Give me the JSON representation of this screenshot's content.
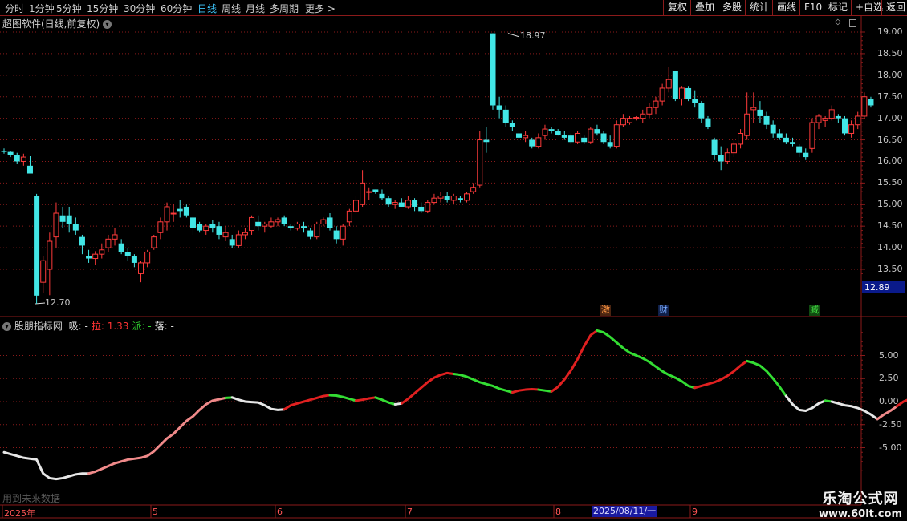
{
  "toolbar": {
    "periods": [
      "分时",
      "1分钟",
      "5分钟",
      "15分钟",
      "30分钟",
      "60分钟",
      "日线",
      "周线",
      "月线",
      "多周期",
      "更多 >"
    ],
    "active_period": "日线",
    "right_buttons": [
      "复权",
      "叠加",
      "多股",
      "统计",
      "画线",
      "F10",
      "标记",
      "+自选",
      "返回"
    ]
  },
  "main_chart": {
    "title": "超图软件(日线,前复权)",
    "y_ticks": [
      "19.00",
      "18.50",
      "18.00",
      "17.50",
      "17.00",
      "16.50",
      "16.00",
      "15.50",
      "15.00",
      "14.50",
      "14.00",
      "13.50"
    ],
    "high_label": "18.97",
    "low_label": "12.70",
    "current_price": "12.89",
    "events": [
      {
        "label": "激",
        "color": "#ff9944"
      },
      {
        "label": "财",
        "color": "#77aaff"
      },
      {
        "label": "减",
        "color": "#44dd44"
      }
    ]
  },
  "indicator": {
    "name": "股朋指标网",
    "fields": [
      {
        "label": "吸:",
        "value": "-",
        "color": "#e0e0e0"
      },
      {
        "label": "拉:",
        "value": "1.33",
        "color": "#ff3333"
      },
      {
        "label": "派:",
        "value": "-",
        "color": "#33dd33"
      },
      {
        "label": "落:",
        "value": "-",
        "color": "#e0e0e0"
      }
    ],
    "y_ticks": [
      "5.00",
      "2.50",
      "0.00",
      "-2.50",
      "-5.00"
    ],
    "note": "用到未来数据"
  },
  "time_axis": {
    "labels": [
      "2025年",
      "5",
      "6",
      "7",
      "8",
      "9"
    ],
    "cursor_date": "2025/08/11/一"
  },
  "watermark": {
    "line1": "乐淘公式网",
    "line2": "www.60lt.com"
  },
  "colors": {
    "up": "#ff3b3b",
    "down": "#42e6e6",
    "grid": "#8b1a1a",
    "bg": "#000000"
  },
  "chart_data": {
    "type": "candlestick",
    "ylim": [
      12.5,
      19.1
    ],
    "candles": [
      [
        16.25,
        16.3,
        16.18,
        16.22
      ],
      [
        16.22,
        16.25,
        16.1,
        16.15
      ],
      [
        16.15,
        16.2,
        15.95,
        16.0
      ],
      [
        16.0,
        16.18,
        15.9,
        16.1
      ],
      [
        15.9,
        16.12,
        15.8,
        15.72
      ],
      [
        15.2,
        15.25,
        12.7,
        12.89
      ],
      [
        13.2,
        13.8,
        12.95,
        13.7
      ],
      [
        13.5,
        14.35,
        12.9,
        14.15
      ],
      [
        14.25,
        15.05,
        14.0,
        14.8
      ],
      [
        14.75,
        14.95,
        14.45,
        14.6
      ],
      [
        14.75,
        14.95,
        14.35,
        14.55
      ],
      [
        14.55,
        14.7,
        14.3,
        14.4
      ],
      [
        14.25,
        14.3,
        13.85,
        14.05
      ],
      [
        13.8,
        13.95,
        13.65,
        13.75
      ],
      [
        13.75,
        13.92,
        13.6,
        13.85
      ],
      [
        13.85,
        14.1,
        13.75,
        13.95
      ],
      [
        14.0,
        14.3,
        13.9,
        14.2
      ],
      [
        14.2,
        14.45,
        14.05,
        14.3
      ],
      [
        14.1,
        14.2,
        13.85,
        13.9
      ],
      [
        13.9,
        14.0,
        13.7,
        13.8
      ],
      [
        13.8,
        13.85,
        13.55,
        13.65
      ],
      [
        13.4,
        13.7,
        13.2,
        13.65
      ],
      [
        13.65,
        13.95,
        13.55,
        13.9
      ],
      [
        14.0,
        14.3,
        13.95,
        14.25
      ],
      [
        14.35,
        14.7,
        14.2,
        14.6
      ],
      [
        14.6,
        15.05,
        14.4,
        14.95
      ],
      [
        14.8,
        15.0,
        14.6,
        14.8
      ],
      [
        14.9,
        15.1,
        14.7,
        14.85
      ],
      [
        14.95,
        15.0,
        14.7,
        14.75
      ],
      [
        14.7,
        14.75,
        14.3,
        14.45
      ],
      [
        14.55,
        14.6,
        14.35,
        14.4
      ],
      [
        14.4,
        14.55,
        14.3,
        14.5
      ],
      [
        14.55,
        14.65,
        14.35,
        14.45
      ],
      [
        14.5,
        14.6,
        14.2,
        14.3
      ],
      [
        14.25,
        14.5,
        14.15,
        14.35
      ],
      [
        14.2,
        14.3,
        14.0,
        14.05
      ],
      [
        14.05,
        14.4,
        14.0,
        14.3
      ],
      [
        14.3,
        14.45,
        14.2,
        14.35
      ],
      [
        14.4,
        14.75,
        14.3,
        14.7
      ],
      [
        14.6,
        14.75,
        14.4,
        14.5
      ],
      [
        14.5,
        14.6,
        14.35,
        14.55
      ],
      [
        14.5,
        14.7,
        14.45,
        14.6
      ],
      [
        14.6,
        14.7,
        14.5,
        14.65
      ],
      [
        14.7,
        14.75,
        14.5,
        14.55
      ],
      [
        14.5,
        14.55,
        14.4,
        14.45
      ],
      [
        14.45,
        14.6,
        14.4,
        14.55
      ],
      [
        14.5,
        14.6,
        14.35,
        14.45
      ],
      [
        14.4,
        14.45,
        14.2,
        14.25
      ],
      [
        14.25,
        14.6,
        14.2,
        14.55
      ],
      [
        14.55,
        14.7,
        14.5,
        14.65
      ],
      [
        14.7,
        14.8,
        14.4,
        14.45
      ],
      [
        14.4,
        14.5,
        14.1,
        14.2
      ],
      [
        14.2,
        14.55,
        14.05,
        14.5
      ],
      [
        14.6,
        14.9,
        14.5,
        14.85
      ],
      [
        14.85,
        15.2,
        14.8,
        15.1
      ],
      [
        15.0,
        15.8,
        14.95,
        15.5
      ],
      [
        15.3,
        15.4,
        15.1,
        15.3
      ],
      [
        15.35,
        15.35,
        15.25,
        15.3
      ],
      [
        15.25,
        15.35,
        15.1,
        15.15
      ],
      [
        15.15,
        15.2,
        14.95,
        15.0
      ],
      [
        15.0,
        15.1,
        14.9,
        15.05
      ],
      [
        15.05,
        15.15,
        14.95,
        14.95
      ],
      [
        14.95,
        15.2,
        14.9,
        15.1
      ],
      [
        15.1,
        15.15,
        14.85,
        14.95
      ],
      [
        14.95,
        15.05,
        14.8,
        14.85
      ],
      [
        14.85,
        15.1,
        14.8,
        15.05
      ],
      [
        15.05,
        15.25,
        15.0,
        15.15
      ],
      [
        15.15,
        15.3,
        15.05,
        15.2
      ],
      [
        15.2,
        15.3,
        15.05,
        15.1
      ],
      [
        15.1,
        15.25,
        15.0,
        15.2
      ],
      [
        15.15,
        15.2,
        15.05,
        15.1
      ],
      [
        15.1,
        15.3,
        15.05,
        15.25
      ],
      [
        15.3,
        15.5,
        15.25,
        15.4
      ],
      [
        15.45,
        16.7,
        15.4,
        16.5
      ],
      [
        16.5,
        16.8,
        16.2,
        16.45
      ],
      [
        18.97,
        18.97,
        17.2,
        17.3
      ],
      [
        17.3,
        17.5,
        17.0,
        17.2
      ],
      [
        17.2,
        17.3,
        16.8,
        16.9
      ],
      [
        16.9,
        16.95,
        16.7,
        16.8
      ],
      [
        16.65,
        16.7,
        16.45,
        16.55
      ],
      [
        16.55,
        16.7,
        16.45,
        16.6
      ],
      [
        16.5,
        16.55,
        16.3,
        16.35
      ],
      [
        16.35,
        16.65,
        16.3,
        16.55
      ],
      [
        16.6,
        16.85,
        16.5,
        16.75
      ],
      [
        16.75,
        16.8,
        16.65,
        16.7
      ],
      [
        16.7,
        16.75,
        16.6,
        16.62
      ],
      [
        16.62,
        16.7,
        16.5,
        16.55
      ],
      [
        16.6,
        16.65,
        16.4,
        16.45
      ],
      [
        16.45,
        16.7,
        16.4,
        16.65
      ],
      [
        16.55,
        16.6,
        16.4,
        16.45
      ],
      [
        16.45,
        16.8,
        16.4,
        16.75
      ],
      [
        16.75,
        16.85,
        16.6,
        16.65
      ],
      [
        16.65,
        16.7,
        16.4,
        16.45
      ],
      [
        16.45,
        16.6,
        16.3,
        16.35
      ],
      [
        16.35,
        16.95,
        16.3,
        16.85
      ],
      [
        16.85,
        17.1,
        16.8,
        17.0
      ],
      [
        16.9,
        17.05,
        16.85,
        17.0
      ],
      [
        17.0,
        17.05,
        16.95,
        17.02
      ],
      [
        17.0,
        17.2,
        16.9,
        17.1
      ],
      [
        17.1,
        17.35,
        17.0,
        17.25
      ],
      [
        17.25,
        17.5,
        17.1,
        17.4
      ],
      [
        17.4,
        17.8,
        17.3,
        17.7
      ],
      [
        17.7,
        18.2,
        17.6,
        17.9
      ],
      [
        18.1,
        18.1,
        17.4,
        17.45
      ],
      [
        17.45,
        17.75,
        17.3,
        17.7
      ],
      [
        17.7,
        17.75,
        17.4,
        17.45
      ],
      [
        17.45,
        17.65,
        17.25,
        17.35
      ],
      [
        17.35,
        17.4,
        16.9,
        17.0
      ],
      [
        17.0,
        17.05,
        16.75,
        16.8
      ],
      [
        16.5,
        16.55,
        16.05,
        16.15
      ],
      [
        16.15,
        16.35,
        15.8,
        16.0
      ],
      [
        16.0,
        16.3,
        15.95,
        16.2
      ],
      [
        16.2,
        16.5,
        16.1,
        16.4
      ],
      [
        16.4,
        16.75,
        16.3,
        16.65
      ],
      [
        16.6,
        17.6,
        16.5,
        17.1
      ],
      [
        17.2,
        17.6,
        16.9,
        17.25
      ],
      [
        17.2,
        17.4,
        16.9,
        17.05
      ],
      [
        17.05,
        17.15,
        16.75,
        16.85
      ],
      [
        16.85,
        16.95,
        16.55,
        16.65
      ],
      [
        16.65,
        16.75,
        16.5,
        16.55
      ],
      [
        16.55,
        16.65,
        16.4,
        16.45
      ],
      [
        16.45,
        16.55,
        16.35,
        16.4
      ],
      [
        16.35,
        16.4,
        16.1,
        16.2
      ],
      [
        16.2,
        16.3,
        16.05,
        16.1
      ],
      [
        16.3,
        17.0,
        16.2,
        16.9
      ],
      [
        16.9,
        17.1,
        16.75,
        17.05
      ],
      [
        16.95,
        17.05,
        16.8,
        17.0
      ],
      [
        17.0,
        17.3,
        16.95,
        17.2
      ],
      [
        17.05,
        17.1,
        16.9,
        17.0
      ],
      [
        17.0,
        17.05,
        16.6,
        16.65
      ],
      [
        16.65,
        16.95,
        16.55,
        16.85
      ],
      [
        16.85,
        17.15,
        16.75,
        17.05
      ],
      [
        17.05,
        17.6,
        17.0,
        17.5
      ],
      [
        17.45,
        17.5,
        17.25,
        17.3
      ]
    ],
    "indicator_ylim": [
      -8.5,
      8.0
    ],
    "indicator_segments": [
      {
        "state": "白",
        "color": "#e6e6e6",
        "values": [
          -5.5,
          -5.7,
          -5.9,
          -6.1,
          -6.2,
          -6.3,
          -7.8,
          -8.3,
          -8.4,
          -8.3,
          -8.1,
          -7.9,
          -7.8,
          -7.8
        ]
      },
      {
        "state": "吸",
        "color": "#f08a8a",
        "values": [
          -7.8,
          -7.6,
          -7.3,
          -7.0,
          -6.7,
          -6.5,
          -6.3,
          -6.2,
          -6.1,
          -5.9,
          -5.4,
          -4.7,
          -4.0,
          -3.5,
          -2.8,
          -2.1,
          -1.6,
          -0.9,
          -0.3,
          0.1,
          0.25,
          0.4
        ]
      },
      {
        "state": "派",
        "color": "#33dd33",
        "values": [
          0.4,
          0.45
        ]
      },
      {
        "state": "白",
        "color": "#e6e6e6",
        "values": [
          0.45,
          0.2,
          0.0,
          -0.05,
          -0.1,
          -0.4,
          -0.8,
          -0.9,
          -0.85
        ]
      },
      {
        "state": "拉",
        "color": "#e02020",
        "values": [
          -0.85,
          -0.4,
          -0.2,
          0.0,
          0.2,
          0.4,
          0.6,
          0.7
        ]
      },
      {
        "state": "派",
        "color": "#33dd33",
        "values": [
          0.7,
          0.65,
          0.5,
          0.3,
          0.1
        ]
      },
      {
        "state": "拉",
        "color": "#e02020",
        "values": [
          0.1,
          0.2,
          0.35,
          0.45
        ]
      },
      {
        "state": "派",
        "color": "#33dd33",
        "values": [
          0.45,
          0.2,
          -0.1,
          -0.3
        ]
      },
      {
        "state": "白",
        "color": "#e6e6e6",
        "values": [
          -0.3,
          -0.2
        ]
      },
      {
        "state": "拉",
        "color": "#e02020",
        "values": [
          -0.2,
          0.3,
          0.9,
          1.5,
          2.1,
          2.6,
          2.9,
          3.1,
          3.0
        ]
      },
      {
        "state": "派",
        "color": "#33dd33",
        "values": [
          3.0,
          2.9,
          2.7,
          2.4,
          2.1,
          1.9,
          1.7,
          1.4,
          1.2,
          1.0
        ]
      },
      {
        "state": "拉",
        "color": "#e02020",
        "values": [
          1.0,
          1.2,
          1.3,
          1.35,
          1.3
        ]
      },
      {
        "state": "派",
        "color": "#33dd33",
        "values": [
          1.3,
          1.2,
          1.1
        ]
      },
      {
        "state": "拉",
        "color": "#e02020",
        "values": [
          1.1,
          1.6,
          2.4,
          3.4,
          4.6,
          6.0,
          7.2,
          7.7
        ]
      },
      {
        "state": "派",
        "color": "#33dd33",
        "values": [
          7.7,
          7.5,
          7.0,
          6.4,
          5.8,
          5.3,
          5.0,
          4.7,
          4.3,
          3.8,
          3.3,
          2.9,
          2.6,
          2.2,
          1.7,
          1.5
        ]
      },
      {
        "state": "拉",
        "color": "#e02020",
        "values": [
          1.5,
          1.7,
          1.9,
          2.1,
          2.4,
          2.8,
          3.3,
          3.9,
          4.4
        ]
      },
      {
        "state": "派",
        "color": "#33dd33",
        "values": [
          4.4,
          4.2,
          3.9,
          3.3,
          2.5,
          1.6,
          0.6
        ]
      },
      {
        "state": "白",
        "color": "#e6e6e6",
        "values": [
          0.6,
          -0.3,
          -0.9,
          -1.0,
          -0.7,
          -0.2,
          0.1
        ]
      },
      {
        "state": "派",
        "color": "#33dd33",
        "values": [
          0.1,
          0.0
        ]
      },
      {
        "state": "白",
        "color": "#e6e6e6",
        "values": [
          0.0,
          -0.2,
          -0.4,
          -0.5,
          -0.7,
          -1.0,
          -1.4,
          -1.9
        ]
      },
      {
        "state": "吸",
        "color": "#f08a8a",
        "values": [
          -1.9,
          -1.4,
          -1.0,
          -0.5
        ]
      },
      {
        "state": "拉",
        "color": "#e02020",
        "values": [
          -0.5,
          0.0,
          0.3,
          0.3
        ]
      },
      {
        "state": "派",
        "color": "#33dd33",
        "values": [
          0.3,
          0.0
        ]
      },
      {
        "state": "拉",
        "color": "#e02020",
        "values": [
          0.0,
          0.1,
          0.4,
          0.8,
          1.2,
          1.33
        ]
      }
    ]
  }
}
